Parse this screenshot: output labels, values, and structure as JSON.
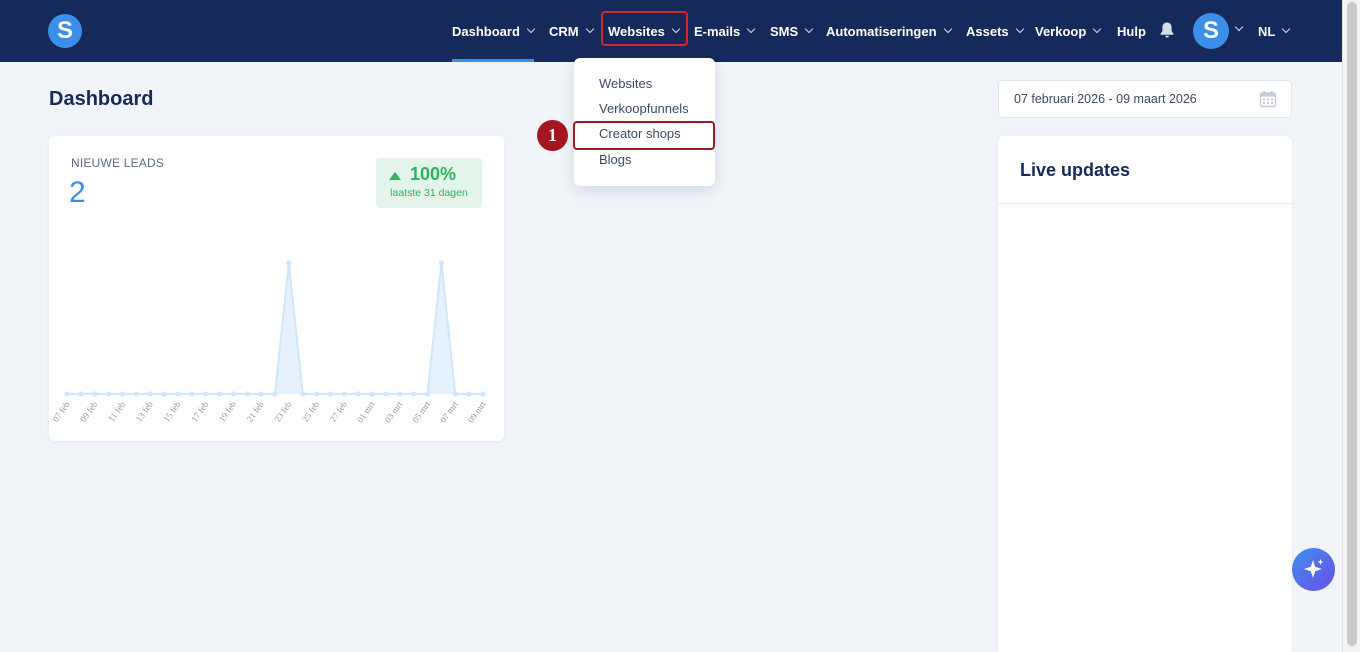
{
  "header": {
    "logo_letter": "S",
    "nav": [
      {
        "label": "Dashboard"
      },
      {
        "label": "CRM"
      },
      {
        "label": "Websites"
      },
      {
        "label": "E-mails"
      },
      {
        "label": "SMS"
      },
      {
        "label": "Automatiseringen"
      },
      {
        "label": "Assets"
      },
      {
        "label": "Verkoop"
      },
      {
        "label": "Hulp"
      }
    ],
    "avatar_letter": "S",
    "language": "NL"
  },
  "websites_menu": {
    "items": [
      {
        "label": "Websites"
      },
      {
        "label": "Verkoopfunnels"
      },
      {
        "label": "Creator shops"
      },
      {
        "label": "Blogs"
      }
    ],
    "step_marker": "1"
  },
  "page": {
    "title": "Dashboard",
    "date_range": "07 februari 2026 - 09 maart 2026"
  },
  "leads_card": {
    "label": "NIEUWE LEADS",
    "value": "2",
    "change_pct": "100%",
    "change_period": "laatste 31 dagen"
  },
  "chart_data": {
    "type": "area",
    "x": [
      "07 feb",
      "08 feb",
      "09 feb",
      "10 feb",
      "11 feb",
      "12 feb",
      "13 feb",
      "14 feb",
      "15 feb",
      "16 feb",
      "17 feb",
      "18 feb",
      "19 feb",
      "20 feb",
      "21 feb",
      "22 feb",
      "23 feb",
      "24 feb",
      "25 feb",
      "26 feb",
      "27 feb",
      "28 feb",
      "01 mrt",
      "02 mrt",
      "03 mrt",
      "04 mrt",
      "05 mrt",
      "06 mrt",
      "07 mrt",
      "08 mrt",
      "09 mrt"
    ],
    "tick_labels": [
      "07 feb",
      "09 feb",
      "11 feb",
      "13 feb",
      "15 feb",
      "17 feb",
      "19 feb",
      "21 feb",
      "23 feb",
      "25 feb",
      "27 feb",
      "01 mrt",
      "03 mrt",
      "05 mrt",
      "07 mrt",
      "09 mrt"
    ],
    "values": [
      0,
      0,
      0,
      0,
      0,
      0,
      0,
      0,
      0,
      0,
      0,
      0,
      0,
      0,
      0,
      0,
      1,
      0,
      0,
      0,
      0,
      0,
      0,
      0,
      0,
      0,
      0,
      1,
      0,
      0,
      0
    ],
    "ylim": [
      0,
      1
    ],
    "grid": false,
    "color": "#cfe6fb"
  },
  "live_updates": {
    "title": "Live updates"
  },
  "colors": {
    "navbar": "#15295b",
    "accent": "#3b8fe8",
    "success": "#2db463",
    "highlight": "#9b1c22"
  }
}
